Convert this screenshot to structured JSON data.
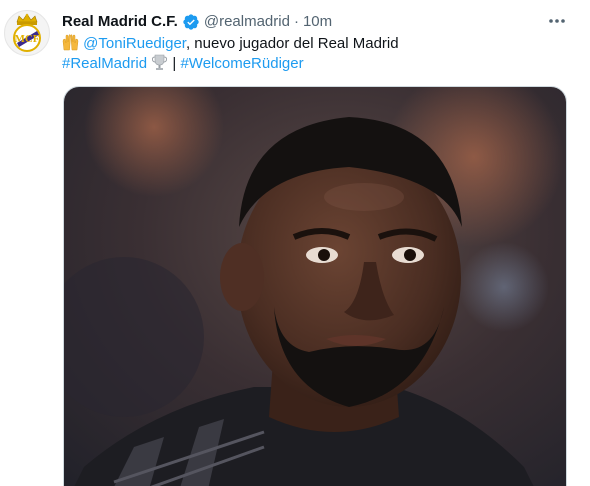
{
  "tweet": {
    "author": {
      "display_name": "Real Madrid C.F.",
      "handle": "@realmadrid",
      "verified_icon": "verified-badge-icon",
      "avatar_icon": "real-madrid-crest-icon"
    },
    "separator": "·",
    "timestamp": "10m",
    "more_icon": "more-options-icon",
    "text": {
      "mention": "@ToniRuediger",
      "body": ", nuevo jugador del Real Madrid",
      "hashtag_1": "#RealMadrid",
      "divider": "|",
      "hashtag_2": "#WelcomeRüdiger",
      "emoji_1": "raising-hands-emoji",
      "emoji_2": "trophy-emoji"
    },
    "media": {
      "type": "photo",
      "subject": "player-portrait"
    }
  },
  "colors": {
    "link": "#1d9bf0",
    "text": "#0f1419",
    "secondary": "#536471",
    "border": "#cfd9de"
  }
}
